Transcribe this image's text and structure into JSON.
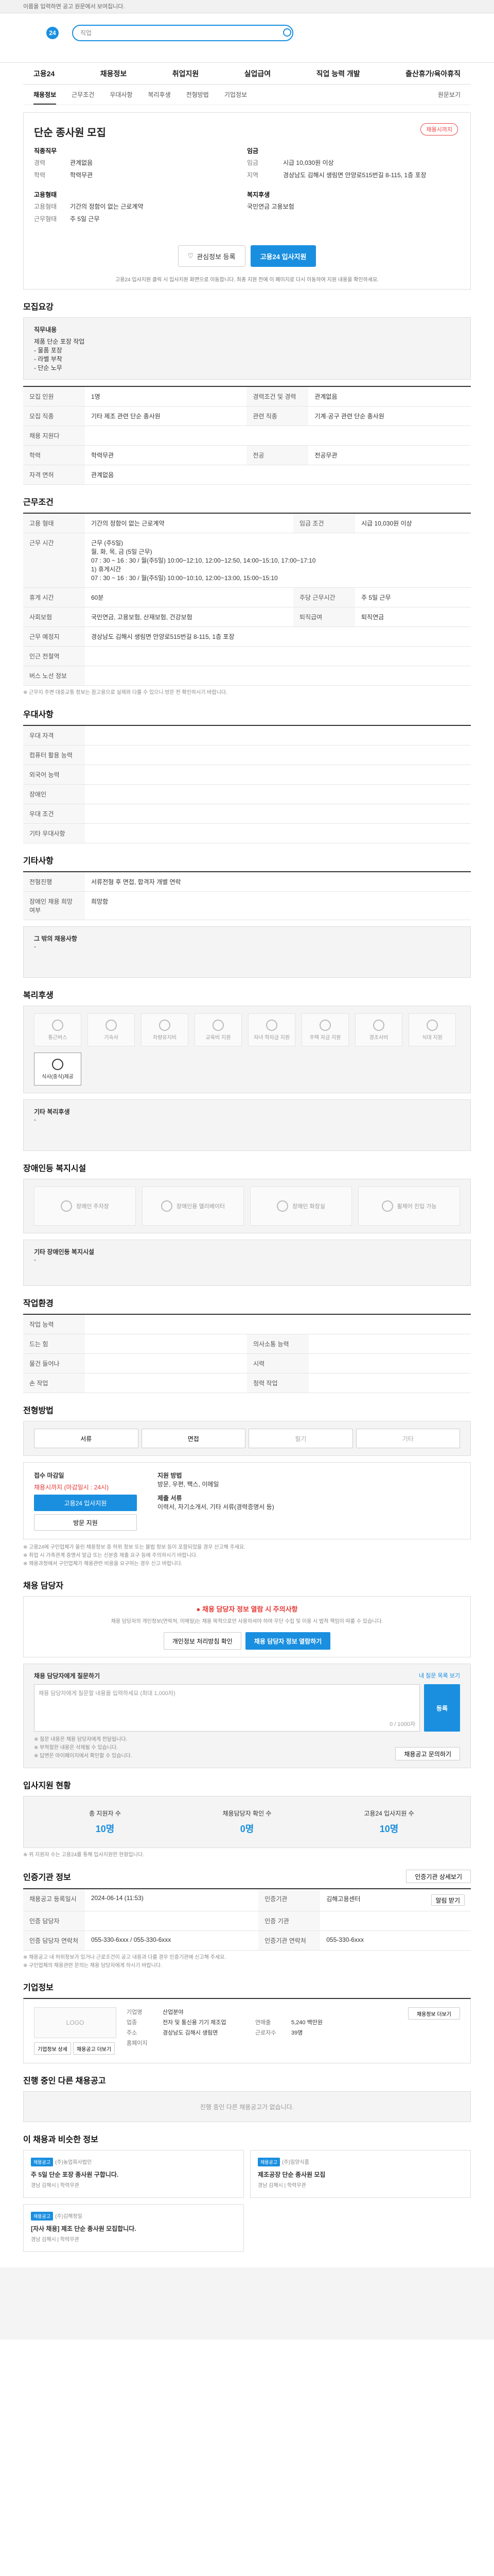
{
  "top": {
    "note": "이름을 입력하면 공고 원문에서 보여집니다.",
    "brand": "고용24",
    "search_placeholder": "직업"
  },
  "gnb": [
    "고용24",
    "채용정보",
    "취업지원",
    "실업급여",
    "직업 능력 개발",
    "출산휴가/육아휴직"
  ],
  "subnav": {
    "items": [
      "채용정보",
      "근무조건",
      "우대사항",
      "복리후생",
      "전형방법",
      "기업정보"
    ],
    "right": "원문보기"
  },
  "job": {
    "title": "단순 종사원 모집",
    "tag": "채용시까지",
    "left": [
      {
        "k": "직종직무",
        "v": ""
      },
      {
        "k": "경력",
        "v": "관계없음"
      },
      {
        "k": "학력",
        "v": "학력무관"
      }
    ],
    "right": [
      {
        "k": "임금",
        "v": ""
      },
      {
        "k": "임금",
        "v": "시급 10,030원 이상"
      },
      {
        "k": "지역",
        "v": "경상남도 김해시 생림면 안양로515번길 8-115, 1층 포장"
      }
    ],
    "left2": [
      {
        "k": "고용형태",
        "v": ""
      },
      {
        "k": "고용형태",
        "v": "기간의 정함이 없는 근로계약"
      },
      {
        "k": "근무형태",
        "v": "주 5일 근무"
      }
    ],
    "right2": [
      {
        "k": "복지후생",
        "v": ""
      },
      {
        "k": "",
        "v": "국민연금 고용보험"
      }
    ],
    "btn_scrap": "관심정보 등록",
    "btn_apply": "고용24 입사지원",
    "note": "고용24 입사지원 클릭 시 입사지원 화면으로 이동합니다. 최종 지원 전에 이 페이지로 다시 이동하여 지원 내용을 확인하세요."
  },
  "section_titles": {
    "mojib": "모집요강",
    "working": "근무조건",
    "pref": "우대사항",
    "etc": "기타사항",
    "welfare": "복리후생",
    "disabled": "장애인등 복지시설",
    "jobinfo": "작업환경",
    "selection": "전형방법",
    "manager": "채용 담당자",
    "status": "입사지원 현황",
    "agency": "인증기관 정보",
    "company": "기업정보",
    "same": "진행 중인 다른 채용공고",
    "recommend": "이 채용과 비슷한 정보"
  },
  "mojib": {
    "job_title": "직무내용",
    "job_lines": [
      "제품 단순 포장 작업",
      "- 물품 포장",
      "- 라벨 부착",
      "- 단순 노무"
    ],
    "rows": [
      [
        "모집 인원",
        "1명",
        "경력조건 및 경력",
        "관계없음"
      ],
      [
        "모집 직종",
        "기타 제조 관련 단순 종사원",
        "관련 직종",
        "기계·공구 관련 단순 종사원"
      ],
      [
        "채용 지원다",
        "",
        "",
        ""
      ],
      [
        "학력",
        "학력무관",
        "전공",
        "전공무관"
      ],
      [
        "자격 면허",
        "관계없음",
        "",
        ""
      ]
    ]
  },
  "working": {
    "rows": [
      [
        "고용 형태",
        "기간의 정함이 없는 근로계약",
        "임금 조건",
        "시급 10,030원 이상"
      ],
      [
        "근무 시간",
        "근무 (주5일)\n월, 화, 목, 금 (5일 근무)\n07 : 30 ~ 16 : 30 / 월(주5일) 10:00~12:10, 12:00~12:50, 14:00~15:10, 17:00~17:10\n1) 휴게시간\n07 : 30 ~ 16 : 30 / 월(주5일) 10:00~10:10, 12:00~13:00, 15:00~15:10",
        "",
        ""
      ],
      [
        "휴게 시간",
        "60분",
        "주당 근무시간",
        "주 5일 근무"
      ],
      [
        "사회보험",
        "국민연금, 고용보험, 산재보험, 건강보험",
        "퇴직급여",
        "퇴직연금"
      ],
      [
        "근무 예정지",
        "경상남도 김해시 생림면 안양로515번길 8-115, 1층 포장",
        "",
        ""
      ],
      [
        "인근 전철역",
        "",
        "",
        ""
      ],
      [
        "버스 노선 정보",
        "",
        "",
        ""
      ]
    ],
    "note": "※ 근무지 주변 대중교통 정보는 참고용으로 실제와 다를 수 있으니 방문 전 확인하시기 바랍니다."
  },
  "pref": {
    "rows": [
      [
        "우대 자격",
        ""
      ],
      [
        "컴퓨터 활용 능력",
        ""
      ],
      [
        "외국어 능력",
        ""
      ],
      [
        "장애인",
        ""
      ],
      [
        "우대 조건",
        ""
      ],
      [
        "기타 우대사항",
        ""
      ]
    ]
  },
  "etc": {
    "rows": [
      [
        "전형진행",
        "서류전형 후 면접, 합격자 개별 연락"
      ],
      [
        "장애인 채용 희망 여부",
        "희망함"
      ]
    ],
    "box_title": "그 밖의 채용사항",
    "box_body": "-"
  },
  "welfare": {
    "icons": [
      "통근버스",
      "기숙사",
      "차량유지비",
      "교육비 지원",
      "자녀 학자금 지원",
      "주택 자금 지원",
      "경조사비",
      "식대 지원",
      "식사(중식)제공"
    ],
    "box_title": "기타 복리후생",
    "box_body": "-"
  },
  "disabled": {
    "icons": [
      "장애인 주차장",
      "장애인용 엘리베이터",
      "장애인 화장실",
      "휠체어 진입 가능"
    ],
    "box_title": "기타 장애인등 복지시설",
    "box_body": "-"
  },
  "jobinfo": {
    "rows": [
      [
        "작업 능력",
        "",
        "",
        ""
      ],
      [
        "드는 힘",
        "",
        "의사소통 능력",
        ""
      ],
      [
        "물건 들어나",
        "",
        "시력",
        ""
      ],
      [
        "손 작업",
        "",
        "청력 작업",
        ""
      ]
    ]
  },
  "selection": {
    "tabs": [
      "서류",
      "면접",
      "필기",
      "기타"
    ],
    "apply_label": "접수 마감일",
    "apply_value": "채용시까지 (마감일시 : 24시)",
    "btn_apply": "고용24 입사지원",
    "btn_visit": "방문 지원",
    "docs_label": "제출 서류",
    "docs_value": "이력서, 자기소개서, 기타 서류(경력증명서 등)",
    "method_label": "지원 방법",
    "method_value": "방문, 우편, 팩스, 이메일",
    "notes": [
      "※ 고용24에 구인업체가 올린 채용정보 중 허위 정보 또는 불법 정보 등이 포함되었을 경우 신고해 주세요.",
      "※ 취업 시 가족관계 증명서 발급 또는 신분증 제출 요구 등에 주의하시기 바랍니다.",
      "※ 채용과정에서 구인업체가 채용관련 비용을 요구하는 경우 신고 바랍니다."
    ]
  },
  "manager": {
    "warn_title": "채용 담당자 정보 열람 시 주의사항",
    "warn_body": "채용 담당자의 개인정보(연락처, 이메일)는 채용 목적으로만 사용하셔야 하며 무단 수집 및 이용 시 법적 책임이 따를 수 있습니다.",
    "btn_personal": "개인정보 처리방침 확인",
    "btn_view": "채용 담당자 정보 열람하기",
    "q_title": "채용 담당자에게 질문하기",
    "q_link": "내 질문 목록 보기",
    "q_placeholder": "채용 담당자에게 질문할 내용을 입력하세요 (최대 1,000자)",
    "q_count": "0 / 1000자",
    "q_submit": "등록",
    "q_notes": [
      "※ 질문 내용은 채용 담당자에게 전달됩니다.",
      "※ 부적절한 내용은 삭제될 수 있습니다.",
      "※ 답변은 마이페이지에서 확인할 수 있습니다."
    ],
    "q_btn": "채용공고 문의하기"
  },
  "status": {
    "items": [
      {
        "label": "총 지원자 수",
        "value": "10명"
      },
      {
        "label": "채용담당자 확인 수",
        "value": "0명"
      },
      {
        "label": "고용24 입사지원 수",
        "value": "10명"
      }
    ],
    "note": "※ 위 지원자 수는 고용24를 통해 입사지원한 현황입니다."
  },
  "agency": {
    "btn": "인증기관 상세보기",
    "rows": [
      [
        "채용공고 등록일시",
        "2024-06-14 (11:53)",
        "인증기관",
        "김해고용센터",
        "알림 받기"
      ],
      [
        "인증 담당자",
        "",
        "인증 기관",
        ""
      ],
      [
        "인증 담당자 연락처",
        "055-330-6xxx / 055-330-6xxx",
        "인증기관 연락처",
        "055-330-6xxx"
      ]
    ],
    "notes": [
      "※ 채용공고 내 허위정보가 있거나 근로조건이 공고 내용과 다를 경우 인증기관에 신고해 주세요.",
      "※ 구인업체의 채용관련 문의는 채용 담당자에게 하시기 바랍니다."
    ]
  },
  "company": {
    "logo": "LOGO",
    "btn1": "기업정보 상세",
    "btn2": "채용공고 더보기",
    "rows": [
      [
        "기업명",
        "산업분야",
        "",
        "업종"
      ],
      [
        "업종",
        "전자 및 통신용 기기 제조업",
        "연매출",
        "5,240 백만원"
      ],
      [
        "주소",
        "경상남도 김해시 생림면",
        "근로자수",
        "39명"
      ],
      [
        "홈페이지",
        "",
        "",
        ""
      ]
    ],
    "btn_more": "채용정보 더보기"
  },
  "same": {
    "empty": "진행 중인 다른 채용공고가 없습니다."
  },
  "recommend": {
    "cards": [
      {
        "badge": "채용공고",
        "company": "(주)농업회사법인",
        "title": "주 5일 단순 포장 종사원 구합니다.",
        "meta": "경남 김해시 | 학력무관"
      },
      {
        "badge": "채용공고",
        "company": "(주)밀양식품",
        "title": "제조공장 단순 종사원 모집",
        "meta": "경남 김해시 | 학력무관"
      },
      {
        "badge": "채용공고",
        "company": "(주)김해정밀",
        "title": "[자사 채용] 제조 단순 종사원 모집합니다.",
        "meta": "경남 김해시 | 학력무관"
      }
    ]
  }
}
